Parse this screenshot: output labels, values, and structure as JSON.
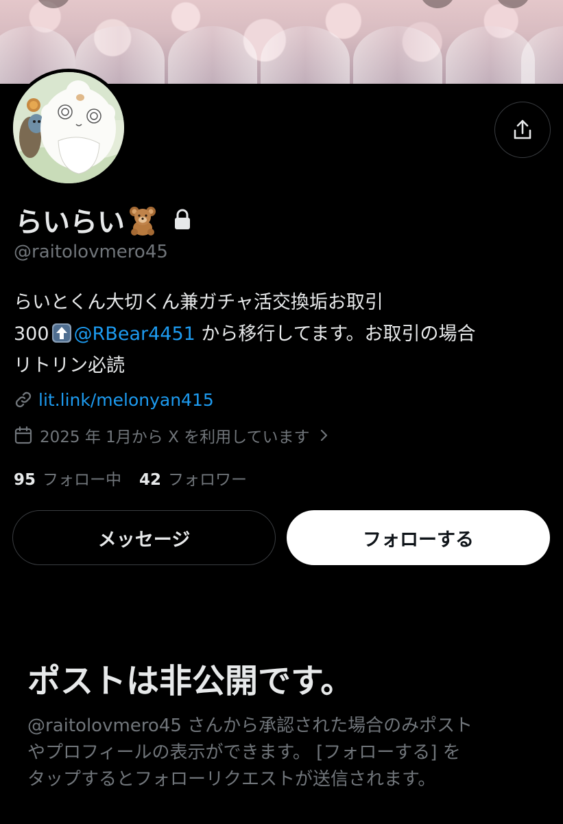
{
  "profile": {
    "display_name": "らいらい",
    "display_name_emoji": "teddy-bear-emoji",
    "protected": true,
    "handle": "@raitolovmero45",
    "bio": {
      "line1": "らいとくん大切くん兼ガチャ活交換垢お取引",
      "line2_prefix": "300",
      "line2_emoji": "up-arrow-emoji",
      "line2_mention": "@RBear4451",
      "line2_suffix": " から移行してます。お取引の場合",
      "line3": "リトリン必読"
    },
    "link": "lit.link/melonyan415",
    "joined": "2025 年 1月から X を利用しています",
    "stats": {
      "following_count": "95",
      "following_label": "フォロー中",
      "followers_count": "42",
      "followers_label": "フォロワー"
    }
  },
  "actions": {
    "message_label": "メッセージ",
    "follow_label": "フォローする"
  },
  "private_notice": {
    "title": "ポストは非公開です。",
    "line1": "@raitolovmero45 さんから承認された場合のみポスト",
    "line2": "やプロフィールの表示ができます。 [フォローする] を",
    "line3": "タップするとフォローリクエストが送信されます。"
  },
  "colors": {
    "background": "#000000",
    "text_primary": "#e7e9ea",
    "text_secondary": "#71767b",
    "accent_blue": "#1d9bf0",
    "button_border": "#3a3d41"
  },
  "icons": [
    "share-icon",
    "lock-icon",
    "link-icon",
    "calendar-icon",
    "chevron-right-icon"
  ]
}
